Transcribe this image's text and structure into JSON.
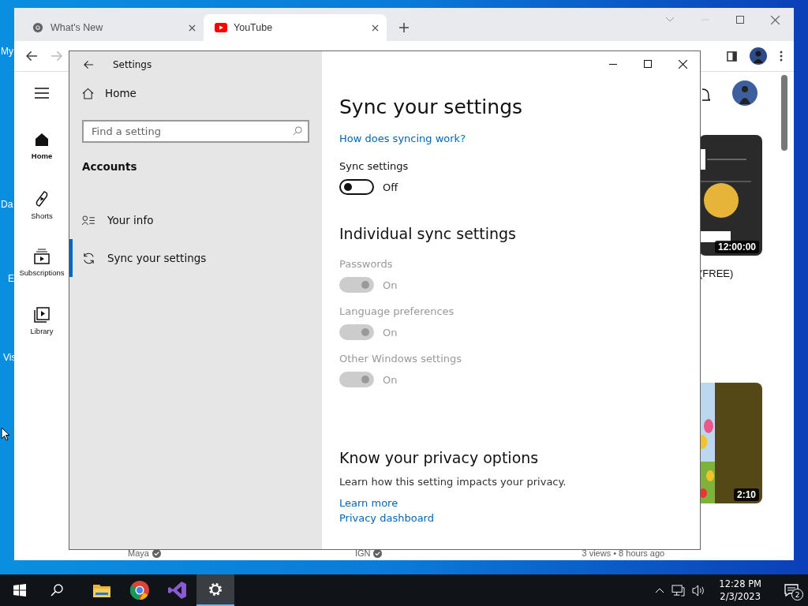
{
  "desktop": {
    "icon_labels": [
      {
        "label": "My"
      },
      {
        "label": "Da"
      },
      {
        "label": "E"
      },
      {
        "label": "Vis"
      }
    ]
  },
  "browser": {
    "tabs": [
      {
        "label": "What's New",
        "selected": false,
        "kind": "chrome"
      },
      {
        "label": "YouTube",
        "selected": true,
        "kind": "youtube"
      }
    ],
    "nav": [
      {
        "label": "Home",
        "selected": true,
        "kind": "home"
      },
      {
        "label": "Shorts",
        "selected": false,
        "kind": "shorts"
      },
      {
        "label": "Subscriptions",
        "selected": false,
        "kind": "subscriptions"
      },
      {
        "label": "Library",
        "selected": false,
        "kind": "library"
      }
    ],
    "videos": [
      {
        "kind": "dark",
        "duration": "12:00:00",
        "title": "(FREE)"
      },
      {
        "kind": "flowers",
        "duration": "2:10"
      }
    ],
    "channels": [
      {
        "name": "Maya",
        "verified": true
      },
      {
        "name": "IGN",
        "verified": true
      }
    ],
    "meta": "3 views • 8 hours ago"
  },
  "settings": {
    "title": "Settings",
    "home": "Home",
    "search": {
      "placeholder": "Find a setting"
    },
    "section": "Accounts",
    "items": [
      {
        "label": "Your info",
        "selected": false,
        "kind": "person"
      },
      {
        "label": "Sync your settings",
        "selected": true,
        "kind": "sync"
      }
    ],
    "heading": "Sync your settings",
    "help_link": "How does syncing work?",
    "sync": {
      "label": "Sync settings",
      "on": false,
      "disabled": false,
      "state_text": "Off"
    },
    "individual_heading": "Individual sync settings",
    "toggles": [
      {
        "label": "Passwords",
        "on": true,
        "disabled": true,
        "state_text": "On"
      },
      {
        "label": "Language preferences",
        "on": true,
        "disabled": true,
        "state_text": "On"
      },
      {
        "label": "Other Windows settings",
        "on": true,
        "disabled": true,
        "state_text": "On"
      }
    ],
    "privacy": {
      "heading": "Know your privacy options",
      "text": "Learn how this setting impacts your privacy.",
      "links": [
        "Learn more",
        "Privacy dashboard"
      ]
    }
  },
  "taskbar": {
    "apps": [
      {
        "kind": "explorer",
        "selected": false
      },
      {
        "kind": "chrome",
        "selected": false
      },
      {
        "kind": "studio",
        "selected": false
      },
      {
        "kind": "settings",
        "selected": true
      }
    ],
    "time": "12:28 PM",
    "date": "2/3/2023",
    "notifications": "2"
  }
}
